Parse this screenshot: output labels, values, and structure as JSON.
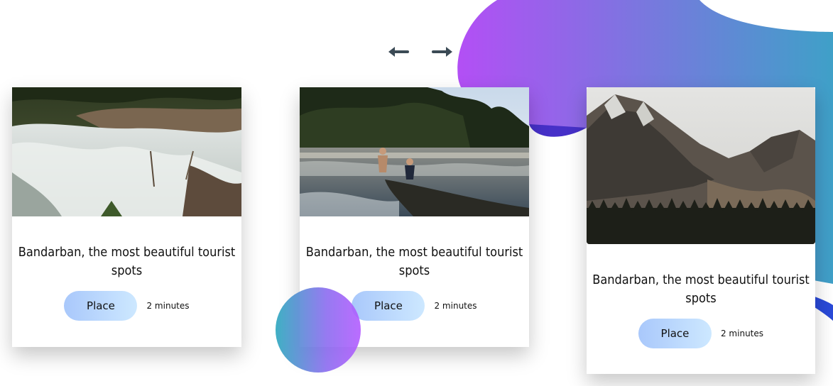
{
  "colors": {
    "blob_gradient_start": "#b34ff5",
    "blob_gradient_end": "#3fa0c8",
    "ribbon": "#3a44d6",
    "button_bg_start": "#a9c8fb",
    "button_bg_end": "#cde8ff"
  },
  "navigation": {
    "prev_icon": "arrow-left-icon",
    "next_icon": "arrow-right-icon"
  },
  "cards": [
    {
      "image": "waterfall-photo",
      "title": "Bandarban, the most beautiful tourist spots",
      "button_label": "Place",
      "duration": "2 minutes"
    },
    {
      "image": "river-boat-photo",
      "title": "Bandarban, the most beautiful tourist spots",
      "button_label": "Place",
      "duration": "2 minutes"
    },
    {
      "image": "mountain-photo",
      "title": "Bandarban, the most beautiful tourist spots",
      "button_label": "Place",
      "duration": "2 minutes"
    }
  ]
}
